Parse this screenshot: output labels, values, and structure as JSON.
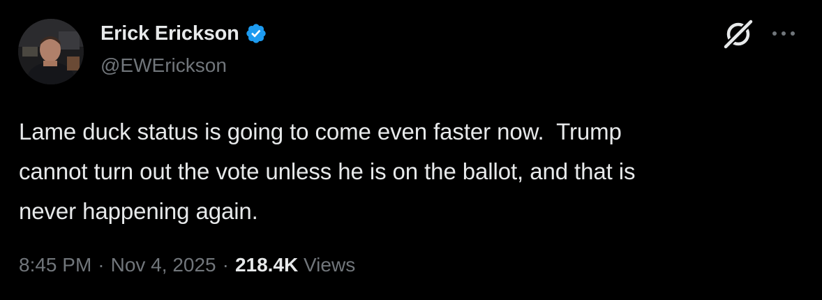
{
  "author": {
    "display_name": "Erick Erickson",
    "handle": "@EWErickson",
    "verified": true
  },
  "post": {
    "text": "Lame duck status is going to come even faster now.  Trump\ncannot turn out the vote unless he is on the ballot, and that is\nnever happening again.",
    "time": "8:45 PM",
    "date": "Nov 4, 2025",
    "views_count": "218.4K",
    "views_label": "Views",
    "separator": "·"
  },
  "icons": {
    "verified": "verified-badge-icon",
    "grok": "grok-icon",
    "more": "more-options-icon"
  },
  "colors": {
    "background": "#000000",
    "text_primary": "#e7e9ea",
    "text_secondary": "#71767b",
    "verified_blue": "#1d9bf0"
  }
}
